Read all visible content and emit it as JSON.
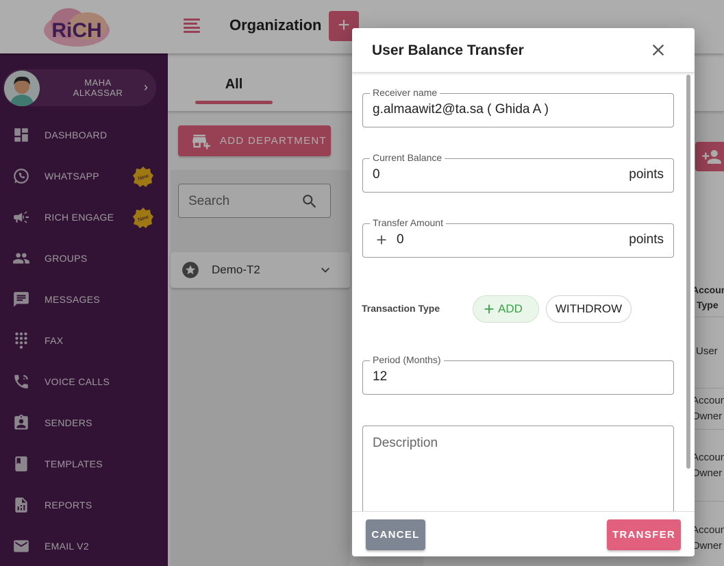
{
  "app": {
    "logo_text": "RiCH",
    "page_title": "Organization",
    "add_label": "+"
  },
  "user": {
    "name_line1": "MAHA",
    "name_line2": "ALKASSAR"
  },
  "sidebar": {
    "items": [
      {
        "label": "DASHBOARD",
        "icon": "dashboard-icon"
      },
      {
        "label": "WHATSAPP",
        "icon": "whatsapp-icon",
        "badge": "New"
      },
      {
        "label": "RICH ENGAGE",
        "icon": "megaphone-icon",
        "badge": "New"
      },
      {
        "label": "GROUPS",
        "icon": "groups-icon"
      },
      {
        "label": "MESSAGES",
        "icon": "message-icon"
      },
      {
        "label": "FAX",
        "icon": "dialpad-icon"
      },
      {
        "label": "VOICE CALLS",
        "icon": "phone-icon"
      },
      {
        "label": "SENDERS",
        "icon": "badge-icon"
      },
      {
        "label": "TEMPLATES",
        "icon": "book-icon"
      },
      {
        "label": "REPORTS",
        "icon": "report-icon"
      },
      {
        "label": "EMAIL V2",
        "icon": "mail-icon"
      }
    ]
  },
  "main": {
    "tab_all": "All",
    "add_department": "ADD DEPARTMENT",
    "search_placeholder": "Search",
    "department": "Demo-T2",
    "table": {
      "col_header_line1": "Account",
      "col_header_line2": "Type",
      "rows": [
        {
          "line1": "User",
          "line2": ""
        },
        {
          "line1": "Account",
          "line2": "Owner"
        },
        {
          "line1": "Account",
          "line2": "Owner"
        },
        {
          "line1": "Account",
          "line2": "Owner"
        }
      ]
    }
  },
  "dialog": {
    "title": "User Balance Transfer",
    "receiver": {
      "label": "Receiver name",
      "value": "g.almaawit2@ta.sa ( Ghida  A )"
    },
    "current_balance": {
      "label": "Current Balance",
      "value": "0",
      "suffix": "points"
    },
    "transfer_amount": {
      "label": "Transfer Amount",
      "value": "0",
      "suffix": "points"
    },
    "transaction_type": {
      "label": "Transaction Type",
      "add": "ADD",
      "withdraw": "WITHDROW",
      "selected": "ADD"
    },
    "period": {
      "label": "Period (Months)",
      "value": "12"
    },
    "description": {
      "placeholder": "Description"
    },
    "cancel": "CANCEL",
    "transfer": "TRANSFER"
  },
  "colors": {
    "accent": "#e0607e",
    "sidebar": "#4a1d4e",
    "add_green": "#3aa14a",
    "cancel_gray": "#7e8593"
  }
}
